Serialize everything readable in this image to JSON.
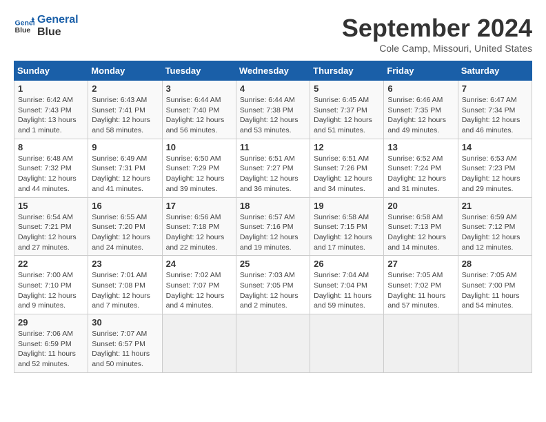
{
  "header": {
    "logo_line1": "General",
    "logo_line2": "Blue",
    "month": "September 2024",
    "location": "Cole Camp, Missouri, United States"
  },
  "weekdays": [
    "Sunday",
    "Monday",
    "Tuesday",
    "Wednesday",
    "Thursday",
    "Friday",
    "Saturday"
  ],
  "weeks": [
    [
      {
        "day": "1",
        "info": "Sunrise: 6:42 AM\nSunset: 7:43 PM\nDaylight: 13 hours\nand 1 minute."
      },
      {
        "day": "2",
        "info": "Sunrise: 6:43 AM\nSunset: 7:41 PM\nDaylight: 12 hours\nand 58 minutes."
      },
      {
        "day": "3",
        "info": "Sunrise: 6:44 AM\nSunset: 7:40 PM\nDaylight: 12 hours\nand 56 minutes."
      },
      {
        "day": "4",
        "info": "Sunrise: 6:44 AM\nSunset: 7:38 PM\nDaylight: 12 hours\nand 53 minutes."
      },
      {
        "day": "5",
        "info": "Sunrise: 6:45 AM\nSunset: 7:37 PM\nDaylight: 12 hours\nand 51 minutes."
      },
      {
        "day": "6",
        "info": "Sunrise: 6:46 AM\nSunset: 7:35 PM\nDaylight: 12 hours\nand 49 minutes."
      },
      {
        "day": "7",
        "info": "Sunrise: 6:47 AM\nSunset: 7:34 PM\nDaylight: 12 hours\nand 46 minutes."
      }
    ],
    [
      {
        "day": "8",
        "info": "Sunrise: 6:48 AM\nSunset: 7:32 PM\nDaylight: 12 hours\nand 44 minutes."
      },
      {
        "day": "9",
        "info": "Sunrise: 6:49 AM\nSunset: 7:31 PM\nDaylight: 12 hours\nand 41 minutes."
      },
      {
        "day": "10",
        "info": "Sunrise: 6:50 AM\nSunset: 7:29 PM\nDaylight: 12 hours\nand 39 minutes."
      },
      {
        "day": "11",
        "info": "Sunrise: 6:51 AM\nSunset: 7:27 PM\nDaylight: 12 hours\nand 36 minutes."
      },
      {
        "day": "12",
        "info": "Sunrise: 6:51 AM\nSunset: 7:26 PM\nDaylight: 12 hours\nand 34 minutes."
      },
      {
        "day": "13",
        "info": "Sunrise: 6:52 AM\nSunset: 7:24 PM\nDaylight: 12 hours\nand 31 minutes."
      },
      {
        "day": "14",
        "info": "Sunrise: 6:53 AM\nSunset: 7:23 PM\nDaylight: 12 hours\nand 29 minutes."
      }
    ],
    [
      {
        "day": "15",
        "info": "Sunrise: 6:54 AM\nSunset: 7:21 PM\nDaylight: 12 hours\nand 27 minutes."
      },
      {
        "day": "16",
        "info": "Sunrise: 6:55 AM\nSunset: 7:20 PM\nDaylight: 12 hours\nand 24 minutes."
      },
      {
        "day": "17",
        "info": "Sunrise: 6:56 AM\nSunset: 7:18 PM\nDaylight: 12 hours\nand 22 minutes."
      },
      {
        "day": "18",
        "info": "Sunrise: 6:57 AM\nSunset: 7:16 PM\nDaylight: 12 hours\nand 19 minutes."
      },
      {
        "day": "19",
        "info": "Sunrise: 6:58 AM\nSunset: 7:15 PM\nDaylight: 12 hours\nand 17 minutes."
      },
      {
        "day": "20",
        "info": "Sunrise: 6:58 AM\nSunset: 7:13 PM\nDaylight: 12 hours\nand 14 minutes."
      },
      {
        "day": "21",
        "info": "Sunrise: 6:59 AM\nSunset: 7:12 PM\nDaylight: 12 hours\nand 12 minutes."
      }
    ],
    [
      {
        "day": "22",
        "info": "Sunrise: 7:00 AM\nSunset: 7:10 PM\nDaylight: 12 hours\nand 9 minutes."
      },
      {
        "day": "23",
        "info": "Sunrise: 7:01 AM\nSunset: 7:08 PM\nDaylight: 12 hours\nand 7 minutes."
      },
      {
        "day": "24",
        "info": "Sunrise: 7:02 AM\nSunset: 7:07 PM\nDaylight: 12 hours\nand 4 minutes."
      },
      {
        "day": "25",
        "info": "Sunrise: 7:03 AM\nSunset: 7:05 PM\nDaylight: 12 hours\nand 2 minutes."
      },
      {
        "day": "26",
        "info": "Sunrise: 7:04 AM\nSunset: 7:04 PM\nDaylight: 11 hours\nand 59 minutes."
      },
      {
        "day": "27",
        "info": "Sunrise: 7:05 AM\nSunset: 7:02 PM\nDaylight: 11 hours\nand 57 minutes."
      },
      {
        "day": "28",
        "info": "Sunrise: 7:05 AM\nSunset: 7:00 PM\nDaylight: 11 hours\nand 54 minutes."
      }
    ],
    [
      {
        "day": "29",
        "info": "Sunrise: 7:06 AM\nSunset: 6:59 PM\nDaylight: 11 hours\nand 52 minutes."
      },
      {
        "day": "30",
        "info": "Sunrise: 7:07 AM\nSunset: 6:57 PM\nDaylight: 11 hours\nand 50 minutes."
      },
      {
        "day": "",
        "info": ""
      },
      {
        "day": "",
        "info": ""
      },
      {
        "day": "",
        "info": ""
      },
      {
        "day": "",
        "info": ""
      },
      {
        "day": "",
        "info": ""
      }
    ]
  ]
}
